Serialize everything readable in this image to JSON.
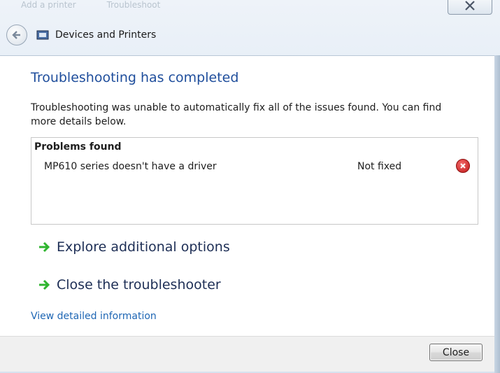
{
  "background": {
    "items": [
      "Add a printer",
      "Troubleshoot"
    ]
  },
  "window": {
    "title": "Devices and Printers"
  },
  "content": {
    "heading": "Troubleshooting has completed",
    "description": "Troubleshooting was unable to automatically fix all of the issues found. You can find more details below.",
    "problems": {
      "title": "Problems found",
      "items": [
        {
          "name": "MP610 series doesn't have a driver",
          "status": "Not fixed",
          "status_icon": "error-icon"
        }
      ]
    },
    "options": [
      {
        "label": "Explore additional options",
        "icon": "green-arrow-icon"
      },
      {
        "label": "Close the troubleshooter",
        "icon": "green-arrow-icon"
      }
    ],
    "details_link": "View detailed information"
  },
  "footer": {
    "close_label": "Close"
  },
  "colors": {
    "heading": "#1f4e9c",
    "link": "#1e66b4",
    "arrow": "#2fb52f",
    "error": "#c01818"
  }
}
